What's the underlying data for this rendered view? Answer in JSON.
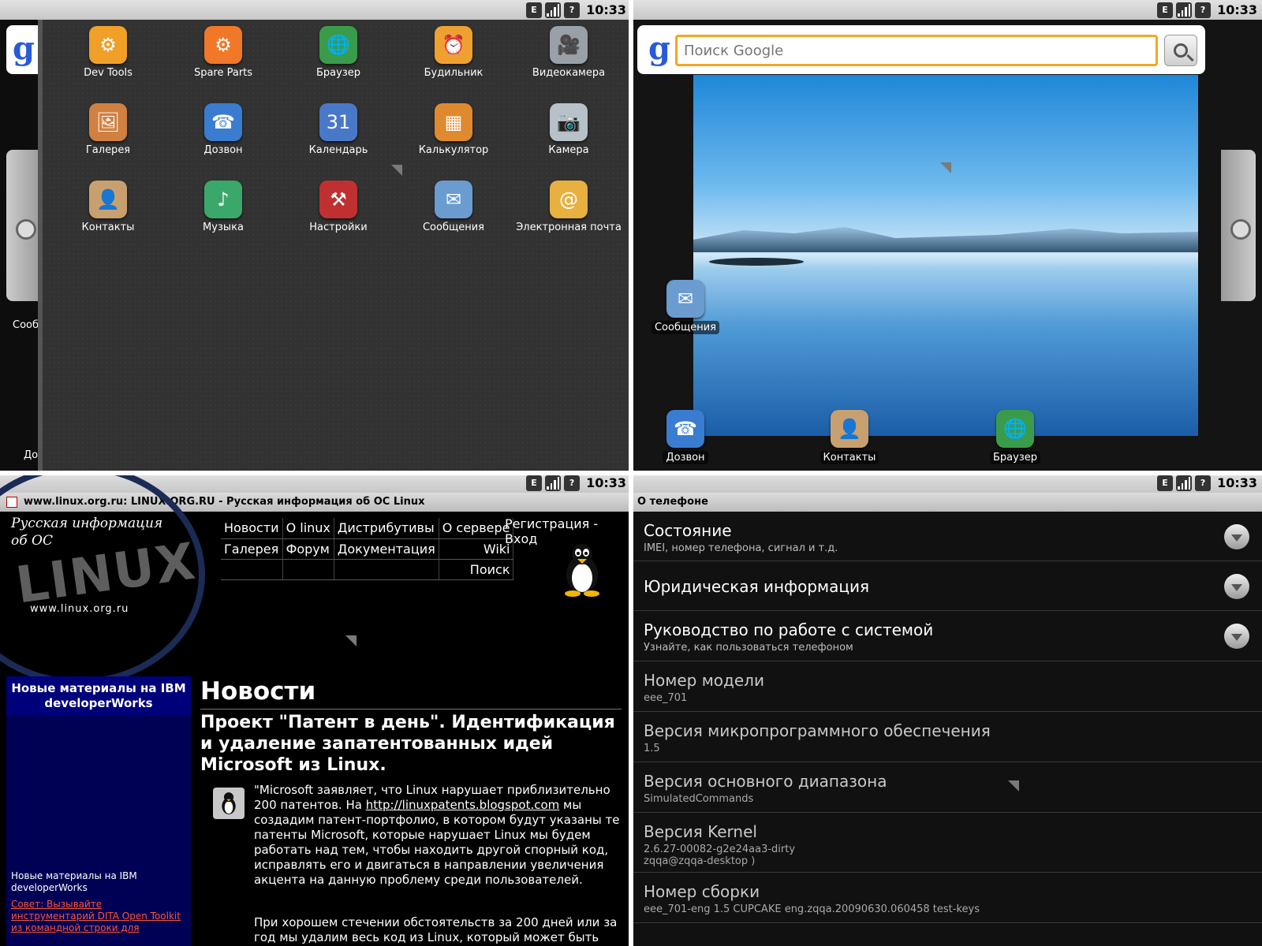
{
  "status_bar": {
    "time": "10:33",
    "icons": [
      "edge-icon",
      "signal-icon",
      "unknown-icon"
    ],
    "edge_label": "E",
    "unknown_label": "?"
  },
  "app_drawer": {
    "search_g": "g",
    "peek_labels": [
      "Сооб",
      "Доз"
    ],
    "apps": [
      {
        "label": "Dev Tools",
        "icon": "gear-icon",
        "glyph": "⚙",
        "color": "#f0a028"
      },
      {
        "label": "Spare Parts",
        "icon": "gear-icon",
        "glyph": "⚙",
        "color": "#f07828"
      },
      {
        "label": "Браузер",
        "icon": "globe-icon",
        "glyph": "🌐",
        "color": "#3a9c4a"
      },
      {
        "label": "Будильник",
        "icon": "alarm-clock-icon",
        "glyph": "⏰",
        "color": "#f0a030"
      },
      {
        "label": "Видеокамера",
        "icon": "video-camera-icon",
        "glyph": "🎥",
        "color": "#9aa0a8"
      },
      {
        "label": "Галерея",
        "icon": "gallery-icon",
        "glyph": "🖼",
        "color": "#d08040"
      },
      {
        "label": "Дозвон",
        "icon": "phone-icon",
        "glyph": "☎",
        "color": "#3a7cd0"
      },
      {
        "label": "Календарь",
        "icon": "calendar-icon",
        "glyph": "31",
        "color": "#4a78c8"
      },
      {
        "label": "Калькулятор",
        "icon": "calculator-icon",
        "glyph": "▦",
        "color": "#e08a30"
      },
      {
        "label": "Камера",
        "icon": "camera-icon",
        "glyph": "📷",
        "color": "#b8c0c8"
      },
      {
        "label": "Контакты",
        "icon": "contacts-icon",
        "glyph": "👤",
        "color": "#c8a070"
      },
      {
        "label": "Музыка",
        "icon": "music-icon",
        "glyph": "♪",
        "color": "#3aa86a"
      },
      {
        "label": "Настройки",
        "icon": "settings-icon",
        "glyph": "⚒",
        "color": "#c03030"
      },
      {
        "label": "Сообщения",
        "icon": "messages-icon",
        "glyph": "✉",
        "color": "#6a9cd0"
      },
      {
        "label": "Электронная почта",
        "icon": "email-icon",
        "glyph": "@",
        "color": "#e8b040"
      }
    ]
  },
  "home": {
    "search_g": "g",
    "search_placeholder": "Поиск Google",
    "desktop_icons": [
      {
        "label": "Сообщения",
        "icon": "messages-icon",
        "glyph": "✉",
        "color": "#6a9cd0"
      },
      {
        "label": "Дозвон",
        "icon": "phone-icon",
        "glyph": "☎",
        "color": "#3a7cd0"
      },
      {
        "label": "Контакты",
        "icon": "contacts-icon",
        "glyph": "👤",
        "color": "#c8a070"
      },
      {
        "label": "Браузер",
        "icon": "globe-icon",
        "glyph": "🌐",
        "color": "#3a9c4a"
      }
    ]
  },
  "browser": {
    "title": "www.linux.org.ru: LINUX.ORG.RU - Русская информация об ОС Linux",
    "logo_title_line1": "Русская информация",
    "logo_title_line2": "об ОС",
    "logo_big": "LINUX",
    "logo_url": "www.linux.org.ru",
    "nav": [
      [
        "Новости",
        "О linux",
        "Дистрибутивы",
        "О сервере"
      ],
      [
        "Галерея",
        "Форум",
        "Документация",
        "Wiki"
      ],
      [
        "",
        "",
        "",
        "Поиск"
      ]
    ],
    "reg_link": "Регистрация - Вход",
    "ibm_header": "Новые материалы на IBM developerWorks",
    "ibm_sub": "Новые материалы на IBM developerWorks",
    "ibm_link": "Совет: Вызывайте инструментарий DITA Open Toolkit из командной строки для",
    "news_heading": "Новости",
    "news_title": "Проект \"Патент в день\". Идентификация и удаление запатентованных идей Microsoft из Linux.",
    "news_body_pre": "\"Microsoft заявляет, что Linux нарушает приблизительно 200 патентов. На ",
    "news_link": "http://linuxpatents.blogspot.com",
    "news_body_post": " мы создадим патент-портфолио, в котором будут указаны те патенты Microsoft, которые нарушает Linux мы будем работать над тем, чтобы находить другой спорный код, исправлять его и двигаться в направлении увеличения акцента на данную проблему среди пользователей.",
    "news_body2": "При хорошем стечении обстоятельств за 200 дней или за год мы удалим весь код из Linux, который может быть"
  },
  "about": {
    "title": "О телефоне",
    "items": [
      {
        "title": "Состояние",
        "summary": "IMEI, номер телефона, сигнал и т.д.",
        "chevron": true
      },
      {
        "title": "Юридическая информация",
        "summary": "",
        "chevron": true
      },
      {
        "title": "Руководство по работе с системой",
        "summary": "Узнайте, как пользоваться телефоном",
        "chevron": true
      },
      {
        "title": "Номер модели",
        "summary": "eee_701",
        "chevron": false
      },
      {
        "title": "Версия микропрограммного обеспечения",
        "summary": "1.5",
        "chevron": false
      },
      {
        "title": "Версия основного диапазона",
        "summary": "SimulatedCommands",
        "chevron": false
      },
      {
        "title": "Версия Kernel",
        "summary": "2.6.27-00082-g2e24aa3-dirty",
        "summary2": "zqqa@zqqa-desktop )",
        "chevron": false
      },
      {
        "title": "Номер сборки",
        "summary": "eee_701-eng 1.5 CUPCAKE eng.zqqa.20090630.060458 test-keys",
        "chevron": false
      }
    ]
  }
}
